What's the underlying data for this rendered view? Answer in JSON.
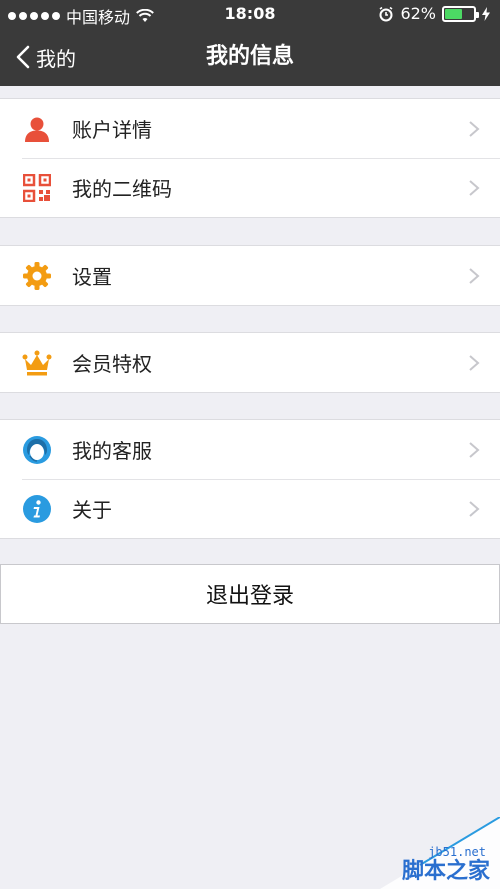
{
  "status": {
    "carrier": "中国移动",
    "time": "18:08",
    "battery": "62%",
    "battery_level": 0.62,
    "battery_color": "#4cd964"
  },
  "nav": {
    "back_label": "我的",
    "title": "我的信息"
  },
  "groups": [
    {
      "items": [
        {
          "label": "账户详情",
          "icon": "person-icon",
          "color": "#e8503a"
        },
        {
          "label": "我的二维码",
          "icon": "qrcode-icon",
          "color": "#e8503a"
        }
      ]
    },
    {
      "items": [
        {
          "label": "设置",
          "icon": "gear-icon",
          "color": "#f39c12"
        }
      ]
    },
    {
      "items": [
        {
          "label": "会员特权",
          "icon": "crown-icon",
          "color": "#f39c12"
        }
      ]
    },
    {
      "items": [
        {
          "label": "我的客服",
          "icon": "headset-icon",
          "color": "#2a9be0"
        },
        {
          "label": "关于",
          "icon": "info-icon",
          "color": "#2a9be0"
        }
      ]
    }
  ],
  "logout_label": "退出登录",
  "watermark": {
    "site": "jb51.net",
    "brand": "脚本之家"
  }
}
